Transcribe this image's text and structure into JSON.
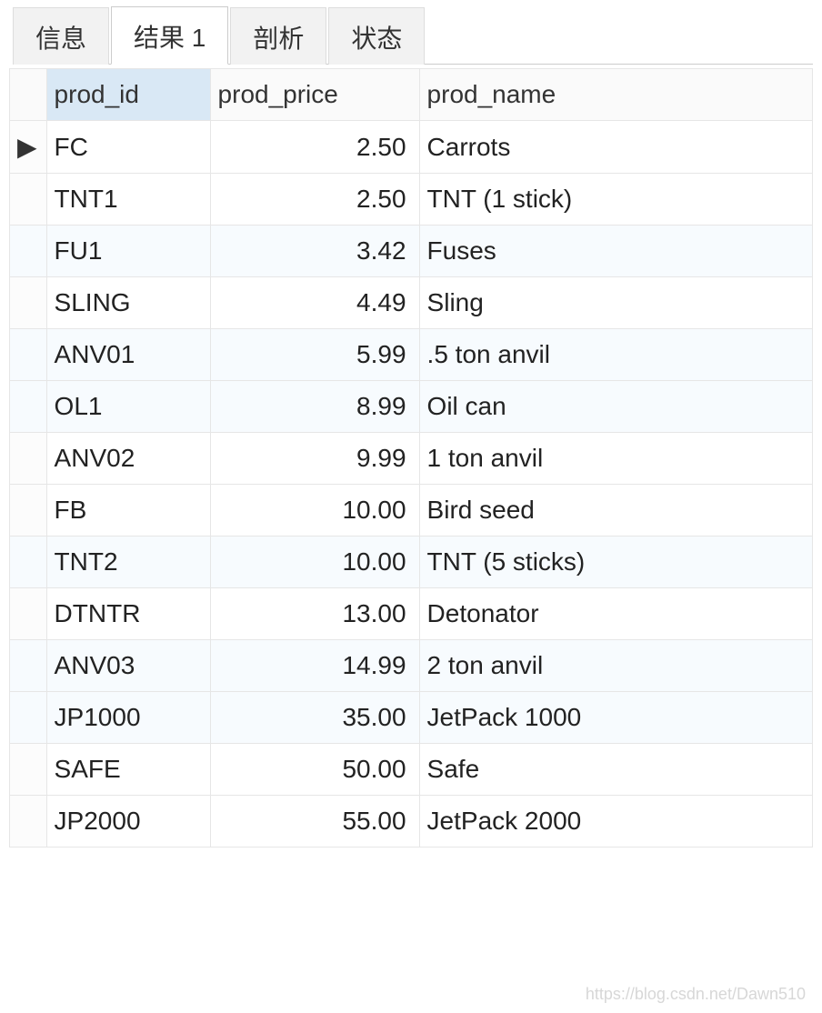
{
  "tabs": [
    {
      "label": "信息",
      "active": false
    },
    {
      "label": "结果 1",
      "active": true
    },
    {
      "label": "剖析",
      "active": false
    },
    {
      "label": "状态",
      "active": false
    }
  ],
  "table": {
    "columns": [
      {
        "key": "prod_id",
        "label": "prod_id",
        "sorted": true
      },
      {
        "key": "prod_price",
        "label": "prod_price",
        "sorted": false
      },
      {
        "key": "prod_name",
        "label": "prod_name",
        "sorted": false
      }
    ],
    "current_row_marker": "▶",
    "rows": [
      {
        "prod_id": "FC",
        "prod_price": "2.50",
        "prod_name": "Carrots",
        "current": true
      },
      {
        "prod_id": "TNT1",
        "prod_price": "2.50",
        "prod_name": "TNT (1 stick)",
        "current": false
      },
      {
        "prod_id": "FU1",
        "prod_price": "3.42",
        "prod_name": "Fuses",
        "current": false
      },
      {
        "prod_id": "SLING",
        "prod_price": "4.49",
        "prod_name": "Sling",
        "current": false
      },
      {
        "prod_id": "ANV01",
        "prod_price": "5.99",
        "prod_name": ".5 ton anvil",
        "current": false
      },
      {
        "prod_id": "OL1",
        "prod_price": "8.99",
        "prod_name": "Oil can",
        "current": false
      },
      {
        "prod_id": "ANV02",
        "prod_price": "9.99",
        "prod_name": "1 ton anvil",
        "current": false
      },
      {
        "prod_id": "FB",
        "prod_price": "10.00",
        "prod_name": "Bird seed",
        "current": false
      },
      {
        "prod_id": "TNT2",
        "prod_price": "10.00",
        "prod_name": "TNT (5 sticks)",
        "current": false
      },
      {
        "prod_id": "DTNTR",
        "prod_price": "13.00",
        "prod_name": "Detonator",
        "current": false
      },
      {
        "prod_id": "ANV03",
        "prod_price": "14.99",
        "prod_name": "2 ton anvil",
        "current": false
      },
      {
        "prod_id": "JP1000",
        "prod_price": "35.00",
        "prod_name": "JetPack 1000",
        "current": false
      },
      {
        "prod_id": "SAFE",
        "prod_price": "50.00",
        "prod_name": "Safe",
        "current": false
      },
      {
        "prod_id": "JP2000",
        "prod_price": "55.00",
        "prod_name": "JetPack 2000",
        "current": false
      }
    ]
  },
  "watermark": "https://blog.csdn.net/Dawn510"
}
